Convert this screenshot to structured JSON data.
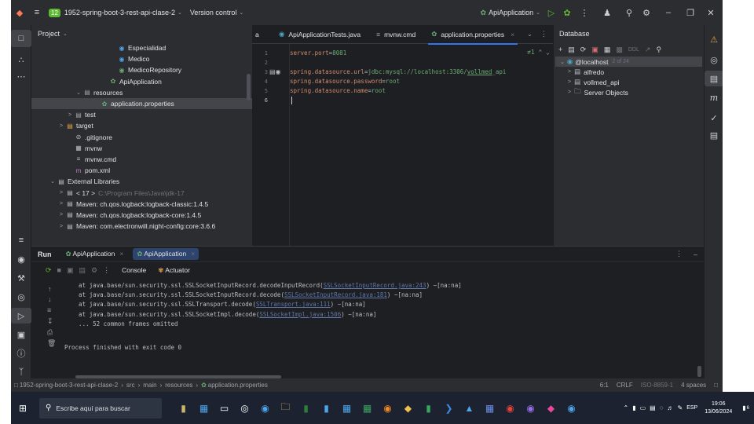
{
  "titlebar": {
    "project_badge": "12",
    "project_name": "1952-spring-boot-3-rest-api-clase-2",
    "vcs_label": "Version control",
    "run_config": "ApiApplication"
  },
  "project_panel": {
    "title": "Project",
    "tree": [
      {
        "label": "Especialidad",
        "icon": "class-icon",
        "depth": 7
      },
      {
        "label": "Medico",
        "icon": "class-icon",
        "depth": 7
      },
      {
        "label": "MedicoRepository",
        "icon": "interface-icon",
        "depth": 7
      },
      {
        "label": "ApiApplication",
        "icon": "spring-icon",
        "depth": 6
      },
      {
        "label": "resources",
        "icon": "folder-icon",
        "depth": 3,
        "arrow": "v"
      },
      {
        "label": "application.properties",
        "icon": "properties-icon",
        "depth": 5,
        "selected": true
      },
      {
        "label": "test",
        "icon": "folder-icon",
        "depth": 2,
        "arrow": ">"
      },
      {
        "label": "target",
        "icon": "folder-orange-icon",
        "depth": 1,
        "arrow": ">"
      },
      {
        "label": ".gitignore",
        "icon": "ignore-icon",
        "depth": 2
      },
      {
        "label": "mvnw",
        "icon": "file-icon",
        "depth": 2
      },
      {
        "label": "mvnw.cmd",
        "icon": "text-icon",
        "depth": 2
      },
      {
        "label": "pom.xml",
        "icon": "maven-icon",
        "depth": 2
      },
      {
        "label": "External Libraries",
        "icon": "library-icon",
        "depth": 0,
        "arrow": "v"
      },
      {
        "label": "< 17 >",
        "icon": "jdk-icon",
        "depth": 1,
        "arrow": ">",
        "extra": "C:\\Program Files\\Java\\jdk-17"
      },
      {
        "label": "Maven: ch.qos.logback:logback-classic:1.4.5",
        "icon": "jar-icon",
        "depth": 1,
        "arrow": ">"
      },
      {
        "label": "Maven: ch.qos.logback:logback-core:1.4.5",
        "icon": "jar-icon",
        "depth": 1,
        "arrow": ">"
      },
      {
        "label": "Maven: com.electronwill.night-config:core:3.6.6",
        "icon": "jar-icon",
        "depth": 1,
        "arrow": ">"
      }
    ]
  },
  "editor": {
    "tabs": [
      {
        "label": "ApiApplicationTests.java",
        "icon": "test-class-icon"
      },
      {
        "label": "mvnw.cmd",
        "icon": "text-icon"
      },
      {
        "label": "application.properties",
        "icon": "properties-icon",
        "active": true
      }
    ],
    "left_fragment": "a",
    "inspection": "≠1",
    "lines": [
      {
        "num": "1",
        "key": "server.port",
        "value": "8081"
      },
      {
        "num": "2",
        "key": "",
        "value": ""
      },
      {
        "num": "3",
        "key": "spring.datasource.url",
        "value": "jdbc:mysql://localhost:3306/",
        "link": "vollmed",
        "tail": "_api"
      },
      {
        "num": "4",
        "key": "spring.datasource.password",
        "value": "root"
      },
      {
        "num": "5",
        "key": "spring.datasource.name",
        "value": "root"
      },
      {
        "num": "6",
        "key": "",
        "value": ""
      }
    ]
  },
  "database": {
    "title": "Database",
    "host": "@localhost",
    "host_count": "2 of 24",
    "schemas": [
      "alfredo",
      "vollmed_api"
    ],
    "server_objects": "Server Objects",
    "toolbar_ddl": "DDL"
  },
  "run": {
    "label": "Run",
    "tabs": [
      "ApiApplication",
      "ApiApplication"
    ],
    "console_tab": "Console",
    "actuator_tab": "Actuator",
    "log": [
      {
        "pre": "    at java.base/sun.security.ssl.SSLSocketInputRecord.decodeInputRecord(",
        "link": "SSLSocketInputRecord.java:243",
        "post": ") ~[na:na]"
      },
      {
        "pre": "    at java.base/sun.security.ssl.SSLSocketInputRecord.decode(",
        "link": "SSLSocketInputRecord.java:181",
        "post": ") ~[na:na]"
      },
      {
        "pre": "    at java.base/sun.security.ssl.SSLTransport.decode(",
        "link": "SSLTransport.java:111",
        "post": ") ~[na:na]"
      },
      {
        "pre": "    at java.base/sun.security.ssl.SSLSocketImpl.decode(",
        "link": "SSLSocketImpl.java:1506",
        "post": ") ~[na:na]"
      },
      {
        "pre": "    ... 52 common frames omitted",
        "link": "",
        "post": ""
      }
    ],
    "exit_message": "Process finished with exit code 0"
  },
  "statusbar": {
    "crumbs": [
      "1952-spring-boot-3-rest-api-clase-2",
      "src",
      "main",
      "resources",
      "application.properties"
    ],
    "position": "6:1",
    "line_sep": "CRLF",
    "encoding": "ISO-8859-1",
    "indent": "4 spaces"
  },
  "taskbar": {
    "search_placeholder": "Escribe aquí para buscar",
    "lang": "ESP",
    "time": "19:06",
    "date": "13/06/2024",
    "notif_count": "6"
  },
  "colors": {
    "accent": "#3574f0",
    "ide_bg": "#1e1f22",
    "panel_bg": "#2b2d30",
    "key": "#cf8e6d",
    "value": "#6aab73"
  }
}
